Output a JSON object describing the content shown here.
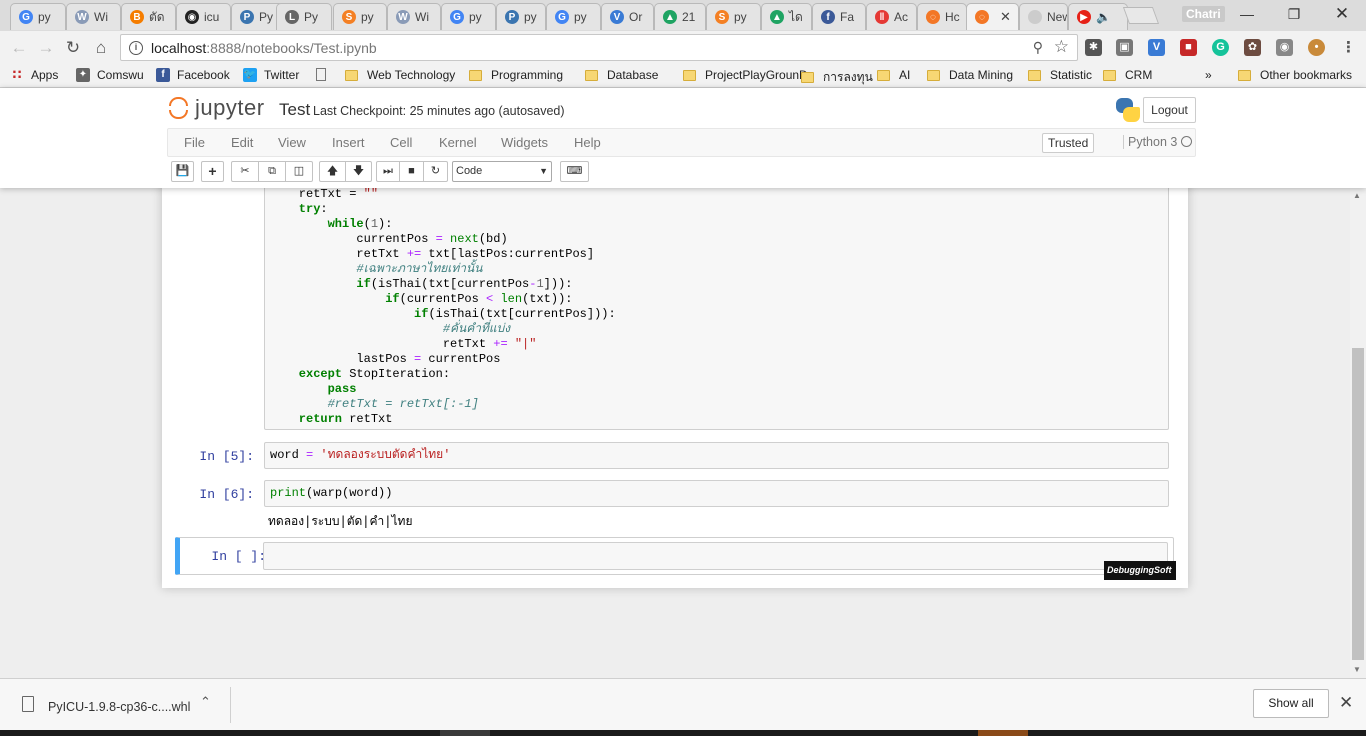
{
  "browser": {
    "tabs": [
      {
        "icon": "google-icon",
        "color": "#4285f4",
        "glyph": "G",
        "label": "py"
      },
      {
        "icon": "wikipedia-icon",
        "color": "#8a9bb7",
        "glyph": "W",
        "label": "Wi"
      },
      {
        "icon": "blogger-icon",
        "color": "#f57d00",
        "glyph": "B",
        "label": "ตัด"
      },
      {
        "icon": "github-icon",
        "color": "#222222",
        "glyph": "◉",
        "label": "icu"
      },
      {
        "icon": "python-icon",
        "color": "#3b75b0",
        "glyph": "P",
        "label": "Py"
      },
      {
        "icon": "lfd-icon",
        "color": "#666666",
        "glyph": "L",
        "label": "Py"
      },
      {
        "icon": "stackoverflow-icon",
        "color": "#f48024",
        "glyph": "S",
        "label": "py"
      },
      {
        "icon": "wikipedia-icon",
        "color": "#8a9bb7",
        "glyph": "W",
        "label": "Wi"
      },
      {
        "icon": "google-icon",
        "color": "#4285f4",
        "glyph": "G",
        "label": "py"
      },
      {
        "icon": "python-icon",
        "color": "#3b75b0",
        "glyph": "P",
        "label": "py"
      },
      {
        "icon": "google-icon",
        "color": "#4285f4",
        "glyph": "G",
        "label": "py"
      },
      {
        "icon": "vue-icon",
        "color": "#3a7bd5",
        "glyph": "V",
        "label": "Or"
      },
      {
        "icon": "drive-icon",
        "color": "#1fa463",
        "glyph": "▲",
        "label": "21"
      },
      {
        "icon": "stackoverflow-icon",
        "color": "#f48024",
        "glyph": "S",
        "label": "py"
      },
      {
        "icon": "drive-icon",
        "color": "#1fa463",
        "glyph": "▲",
        "label": "ได"
      },
      {
        "icon": "facebook-icon",
        "color": "#3b5998",
        "glyph": "f",
        "label": "Fa"
      },
      {
        "icon": "pause-icon",
        "color": "#e53935",
        "glyph": "‖",
        "label": "Ac"
      },
      {
        "icon": "jupyter-icon",
        "color": "#f37726",
        "glyph": "◌",
        "label": "Hc"
      },
      {
        "icon": "jupyter-icon",
        "color": "#f37726",
        "glyph": "◌",
        "label": "",
        "active": true
      },
      {
        "icon": "newtab-icon",
        "color": "#cccccc",
        "glyph": "",
        "label": "New T"
      },
      {
        "icon": "youtube-icon",
        "color": "#e62117",
        "glyph": "▶",
        "label": "🔈"
      }
    ],
    "profile_name": "Chatri",
    "url_host": "localhost",
    "url_path": ":8888/notebooks/Test.ipynb",
    "bookmarks": [
      {
        "type": "apps",
        "label": "Apps"
      },
      {
        "type": "site",
        "label": "Comswu",
        "icon": "comswu-icon",
        "color": "#666666",
        "glyph": "✦"
      },
      {
        "type": "site",
        "label": "Facebook",
        "icon": "facebook-icon",
        "color": "#3b5998",
        "glyph": "f"
      },
      {
        "type": "site",
        "label": "Twitter",
        "icon": "twitter-icon",
        "color": "#1da1f2",
        "glyph": "🐦"
      },
      {
        "type": "page",
        "label": "",
        "icon": "page-icon"
      },
      {
        "type": "folder",
        "label": "Web Technology"
      },
      {
        "type": "folder",
        "label": "Programming"
      },
      {
        "type": "folder",
        "label": "Database"
      },
      {
        "type": "folder",
        "label": "ProjectPlayGrounD"
      },
      {
        "type": "folder",
        "label": "การลงทุน"
      },
      {
        "type": "folder",
        "label": "AI"
      },
      {
        "type": "folder",
        "label": "Data Mining"
      },
      {
        "type": "folder",
        "label": "Statistic"
      },
      {
        "type": "folder",
        "label": "CRM"
      }
    ],
    "bookmarks_overflow": "»",
    "other_bookmarks": "Other bookmarks"
  },
  "jupyter": {
    "logo_text": "jupyter",
    "notebook_name": "Test",
    "checkpoint": "Last Checkpoint: 25 minutes ago (autosaved)",
    "logout_label": "Logout",
    "menu": [
      "File",
      "Edit",
      "View",
      "Insert",
      "Cell",
      "Kernel",
      "Widgets",
      "Help"
    ],
    "trusted_label": "Trusted",
    "kernel_name": "Python 3",
    "cell_type": "Code"
  },
  "cells": {
    "cell4_prompt": "",
    "cell4_lines": [
      [
        [
          "",
          "    retTxt = "
        ],
        [
          "str",
          "\"\""
        ]
      ],
      [
        [
          "kw",
          "    try"
        ],
        [
          "",
          ":"
        ]
      ],
      [
        [
          "",
          "        "
        ],
        [
          "kw",
          "while"
        ],
        [
          "",
          "("
        ],
        [
          "num",
          "1"
        ],
        [
          "",
          "):"
        ]
      ],
      [
        [
          "",
          "            currentPos "
        ],
        [
          "op",
          "="
        ],
        [
          "",
          " "
        ],
        [
          "bi",
          "next"
        ],
        [
          "",
          "(bd)"
        ]
      ],
      [
        [
          "",
          "            retTxt "
        ],
        [
          "op",
          "+="
        ],
        [
          "",
          " txt[lastPos:currentPos]"
        ]
      ],
      [
        [
          "cm",
          "            #เฉพาะภาษาไทยเท่านั้น"
        ]
      ],
      [
        [
          "",
          "            "
        ],
        [
          "kw",
          "if"
        ],
        [
          "",
          "(isThai(txt[currentPos"
        ],
        [
          "op",
          "-"
        ],
        [
          "num",
          "1"
        ],
        [
          "",
          "])):"
        ]
      ],
      [
        [
          "",
          "                "
        ],
        [
          "kw",
          "if"
        ],
        [
          "",
          "(currentPos "
        ],
        [
          "op",
          "<"
        ],
        [
          "",
          " "
        ],
        [
          "bi",
          "len"
        ],
        [
          "",
          "(txt)):"
        ]
      ],
      [
        [
          "",
          "                    "
        ],
        [
          "kw",
          "if"
        ],
        [
          "",
          "(isThai(txt[currentPos])):"
        ]
      ],
      [
        [
          "cm",
          "                        #คั่นคำที่แบ่ง"
        ]
      ],
      [
        [
          "",
          "                        retTxt "
        ],
        [
          "op",
          "+="
        ],
        [
          "",
          " "
        ],
        [
          "str",
          "\"|\""
        ]
      ],
      [
        [
          "",
          "            lastPos "
        ],
        [
          "op",
          "="
        ],
        [
          "",
          " currentPos"
        ]
      ],
      [
        [
          "kw",
          "    except"
        ],
        [
          "",
          " StopIteration:"
        ]
      ],
      [
        [
          "kw",
          "        pass"
        ]
      ],
      [
        [
          "cm",
          "        #retTxt = retTxt[:-1]"
        ]
      ],
      [
        [
          "kw",
          "    return"
        ],
        [
          "",
          " retTxt"
        ]
      ]
    ],
    "cell5_prompt": "In [5]:",
    "cell5_lines": [
      [
        [
          "",
          "word "
        ],
        [
          "op",
          "="
        ],
        [
          "",
          " "
        ],
        [
          "str",
          "'ทดลองระบบตัดคำไทย'"
        ]
      ]
    ],
    "cell6_prompt": "In [6]:",
    "cell6_lines": [
      [
        [
          "bi",
          "print"
        ],
        [
          "",
          "(warp(word))"
        ]
      ]
    ],
    "cell6_output": "ทดลอง|ระบบ|ตัด|คำ|ไทย",
    "cell7_prompt": "In [ ]:",
    "watermark": "DebuggingSoft"
  },
  "downloads": {
    "file_name": "PyICU-1.9.8-cp36-c....whl",
    "show_all": "Show all"
  }
}
